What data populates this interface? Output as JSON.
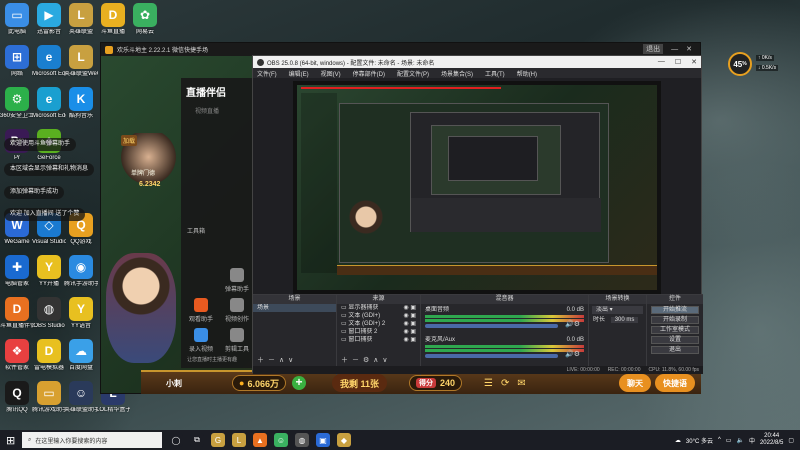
{
  "desktop_icons": [
    {
      "label": "此电脑",
      "color": "#3a8ee6",
      "glyph": "▭",
      "pos": "c0r0"
    },
    {
      "label": "迅雷影音",
      "color": "#2aa9e0",
      "glyph": "▶",
      "pos": "c1r0"
    },
    {
      "label": "英雄联盟",
      "color": "#c8a040",
      "glyph": "L",
      "pos": "c2r0"
    },
    {
      "label": "斗鱼直播",
      "color": "#e8b020",
      "glyph": "D",
      "pos": "c3r0"
    },
    {
      "label": "网易云",
      "color": "#3ab060",
      "glyph": "✿",
      "pos": "c4r0"
    },
    {
      "label": "网络",
      "color": "#2d6ed6",
      "glyph": "⊞",
      "pos": "c0r1"
    },
    {
      "label": "Microsoft Edge",
      "color": "#1a7fd0",
      "glyph": "e",
      "pos": "c1r1"
    },
    {
      "label": "英雄联盟WeGame版",
      "color": "#c8a040",
      "glyph": "L",
      "pos": "c2r1"
    },
    {
      "label": "360安全卫士",
      "color": "#2cb04a",
      "glyph": "⚙",
      "pos": "c0r2"
    },
    {
      "label": "Microsoft Edge",
      "color": "#1a9fd0",
      "glyph": "e",
      "pos": "c1r2"
    },
    {
      "label": "酷狗音乐",
      "color": "#1a8ee8",
      "glyph": "K",
      "pos": "c2r2"
    },
    {
      "label": "Pr",
      "color": "#3a1a55",
      "glyph": "Pr",
      "pos": "c0r3"
    },
    {
      "label": "GeForce",
      "color": "#5ab020",
      "glyph": "◆",
      "pos": "c1r3"
    },
    {
      "label": "WeGame",
      "color": "#2a6ad6",
      "glyph": "W",
      "pos": "c0r5"
    },
    {
      "label": "Visual Studio Code",
      "color": "#1a7ad0",
      "glyph": "◇",
      "pos": "c1r5"
    },
    {
      "label": "QQ游戏",
      "color": "#e8a020",
      "glyph": "Q",
      "pos": "c2r5"
    },
    {
      "label": "电脑管家",
      "color": "#1a6ad0",
      "glyph": "✚",
      "pos": "c0r6"
    },
    {
      "label": "YY开播",
      "color": "#e8c020",
      "glyph": "Y",
      "pos": "c1r6"
    },
    {
      "label": "腾讯手游助手对战平台",
      "color": "#2a8ae0",
      "glyph": "◉",
      "pos": "c2r6"
    },
    {
      "label": "斗鱼直播伴侣",
      "color": "#e87020",
      "glyph": "D",
      "pos": "c0r7"
    },
    {
      "label": "OBS Studio",
      "color": "#333333",
      "glyph": "◍",
      "pos": "c1r7"
    },
    {
      "label": "YY语音",
      "color": "#e8c020",
      "glyph": "Y",
      "pos": "c2r7"
    },
    {
      "label": "软件管家",
      "color": "#e84040",
      "glyph": "❖",
      "pos": "c0r8"
    },
    {
      "label": "雷电模拟器",
      "color": "#e8c020",
      "glyph": "D",
      "pos": "c1r8"
    },
    {
      "label": "百度网盘",
      "color": "#3aa0e8",
      "glyph": "☁",
      "pos": "c2r8"
    },
    {
      "label": "腾讯QQ",
      "color": "#1a1a1a",
      "glyph": "Q",
      "pos": "c0r9"
    },
    {
      "label": "腾讯游戏助手",
      "color": "#d8a030",
      "glyph": "▭",
      "pos": "c1r9"
    },
    {
      "label": "英雄联盟助手",
      "color": "#2a3a5a",
      "glyph": "☺",
      "pos": "c2r9"
    },
    {
      "label": "LOL精华盒子Ver12.12",
      "color": "#2a3a6a",
      "glyph": "L",
      "pos": "c3r9"
    }
  ],
  "chat_overlay": [
    "欢迎使用斗鱼弹幕助手",
    "本区域会显示弹幕和礼物消息",
    "添加弹幕助手成功",
    "欢迎 加入直播间 送了个赞"
  ],
  "game_window": {
    "title": "欢乐斗地主 2.22.2.1 微信快捷手场",
    "top_right": "退出",
    "panel_logo": "直播伴侣",
    "panel_tab": "视频直播",
    "menu_items": [
      "工具箱",
      "弹幕助手",
      "观看助手",
      "视频创作",
      "录入视频",
      "剪辑工具"
    ],
    "footer_note": "让您直播时主播更有趣",
    "player_level": "加载",
    "player_name": "单牌门德",
    "player_coins": "6.2342",
    "bottom_bar": {
      "left_label": "小刺",
      "coins": "6.066万",
      "plus": "+",
      "title": "我剩 11张",
      "score_label": "得分",
      "score": "240",
      "right_btn1": "聊天",
      "right_btn2": "快捷语"
    }
  },
  "obs": {
    "title": "OBS 25.0.8 (64-bit, windows) - 配置文件: 未命名 - 场景: 未命名",
    "menu": [
      "文件(F)",
      "编辑(E)",
      "视图(V)",
      "停靠部件(D)",
      "配置文件(P)",
      "场景集合(S)",
      "工具(T)",
      "帮助(H)"
    ],
    "docks": {
      "scenes": {
        "header": "场景",
        "items": [
          "场景"
        ]
      },
      "sources": {
        "header": "来源",
        "items": [
          "显示器捕获",
          "文本 (GDI+)",
          "文本 (GDI+) 2",
          "窗口捕获 2",
          "窗口捕获"
        ]
      },
      "mixer": {
        "header": "混音器",
        "channels": [
          {
            "name": "桌面音频",
            "db": "0.0 dB"
          },
          {
            "name": "麦克风/Aux",
            "db": "0.0 dB"
          }
        ]
      },
      "transitions": {
        "header": "场景转换",
        "type": "淡出",
        "duration_label": "时长",
        "duration": "300 ms"
      },
      "controls": {
        "header": "控件",
        "buttons": [
          "开始推流",
          "开始录制",
          "工作室模式",
          "设置",
          "退出"
        ]
      }
    },
    "status": [
      "LIVE: 00:00:00",
      "REC: 00:00:00",
      "CPU: 11.8%, 60.00 fps"
    ]
  },
  "speed_widget": {
    "value": "45",
    "unit": "%",
    "up": "0K/s",
    "down": "0.5K/s"
  },
  "taskbar": {
    "search_placeholder": "在这里输入你要搜索的内容",
    "weather": "30°C 多云",
    "ime": "中",
    "time": "20:44",
    "date": "2022/8/5",
    "apps": [
      {
        "glyph": "◯",
        "color": "#1b1d24"
      },
      {
        "glyph": "⧉",
        "color": "#1b1d24"
      },
      {
        "glyph": "G",
        "color": "#c8a040"
      },
      {
        "glyph": "L",
        "color": "#c8a040"
      },
      {
        "glyph": "▲",
        "color": "#e87020"
      },
      {
        "glyph": "☺",
        "color": "#3ab060"
      },
      {
        "glyph": "◍",
        "color": "#555555"
      },
      {
        "glyph": "▣",
        "color": "#2a6ad6"
      },
      {
        "glyph": "◆",
        "color": "#c8a040"
      }
    ]
  }
}
